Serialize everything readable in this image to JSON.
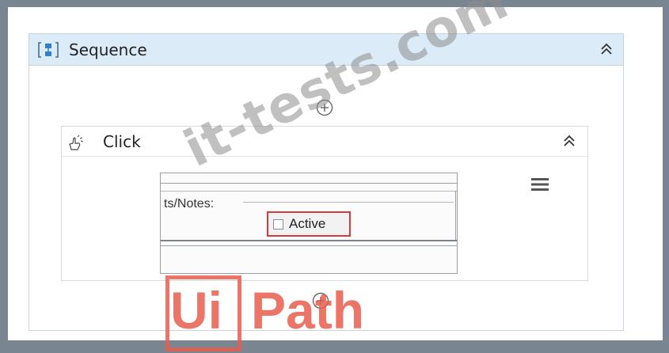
{
  "sequence": {
    "title": "Sequence",
    "icon": "sequence-icon",
    "collapse_icon": "double-chevron-up-icon"
  },
  "click": {
    "title": "Click",
    "icon": "click-hand-icon",
    "collapse_icon": "double-chevron-up-icon",
    "menu_icon": "hamburger-menu-icon"
  },
  "screenshot": {
    "notes_label": "ts/Notes:",
    "checkbox_label": "Active",
    "highlight_color": "#d23c3c"
  },
  "watermark": {
    "text": "it-tests.com"
  },
  "logo": {
    "ui": "Ui",
    "path": "Path",
    "color": "#e85d4c"
  },
  "colors": {
    "header_bg": "#dcebf8",
    "frame_bg": "#7a8592"
  }
}
